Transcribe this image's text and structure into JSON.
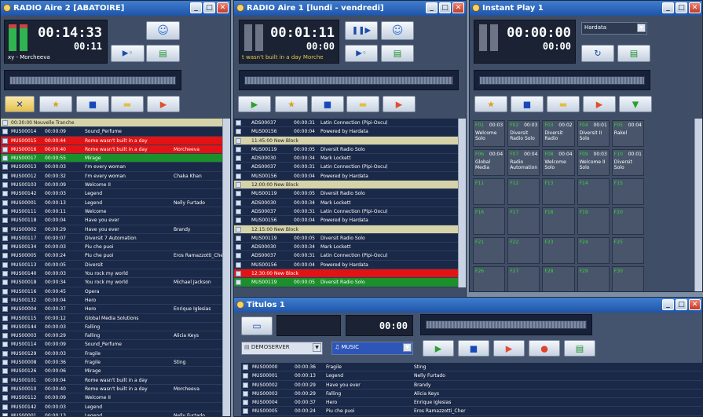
{
  "win1": {
    "title": "RADIO Aire 2 [ABATOIRE]",
    "time": "00:14:33",
    "sub": "00:11",
    "now": "xy - Morcheeva",
    "rows": [
      {
        "t": "ts",
        "icon": "",
        "id": "00:30:00 Nouvelle Tranche",
        "time": "",
        "title": "",
        "artist": ""
      },
      {
        "t": "",
        "icon": "",
        "id": "MUS00014",
        "time": "00:00:09",
        "title": "Sound_Perfume",
        "artist": ""
      },
      {
        "t": "red",
        "icon": "",
        "id": "MUS00015",
        "time": "00:00:44",
        "title": "Rome wasn't built in a day",
        "artist": ""
      },
      {
        "t": "red",
        "icon": "",
        "id": "MUS00016",
        "time": "00:00:40",
        "title": "Rome wasn't built in a day",
        "artist": "Morcheeva"
      },
      {
        "t": "green",
        "icon": "",
        "id": "MUS00017",
        "time": "00:00:55",
        "title": "Mirage",
        "artist": ""
      },
      {
        "t": "",
        "icon": "",
        "id": "MUS00013",
        "time": "00:00:03",
        "title": "I'm every woman",
        "artist": ""
      },
      {
        "t": "",
        "icon": "",
        "id": "MUS00012",
        "time": "00:00:32",
        "title": "I'm every woman",
        "artist": "Chaka Khan"
      },
      {
        "t": "",
        "icon": "",
        "id": "MUS00103",
        "time": "00:00:09",
        "title": "Welcome II",
        "artist": ""
      },
      {
        "t": "",
        "icon": "",
        "id": "MUS00142",
        "time": "00:00:03",
        "title": "Legend",
        "artist": ""
      },
      {
        "t": "",
        "icon": "",
        "id": "MUS00001",
        "time": "00:00:13",
        "title": "Legend",
        "artist": "Nelly Furtado"
      },
      {
        "t": "",
        "icon": "",
        "id": "MUS00111",
        "time": "00:00:11",
        "title": "Welcome",
        "artist": ""
      },
      {
        "t": "",
        "icon": "",
        "id": "MUS00118",
        "time": "00:00:04",
        "title": "Have you ever",
        "artist": ""
      },
      {
        "t": "",
        "icon": "",
        "id": "MUS00002",
        "time": "00:00:29",
        "title": "Have you ever",
        "artist": "Brandy"
      },
      {
        "t": "",
        "icon": "",
        "id": "MUS00117",
        "time": "00:00:07",
        "title": "Diversit 7 Automation",
        "artist": ""
      },
      {
        "t": "",
        "icon": "",
        "id": "MUS00134",
        "time": "00:00:03",
        "title": "Piu che puoi",
        "artist": ""
      },
      {
        "t": "",
        "icon": "",
        "id": "MUS00005",
        "time": "00:00:24",
        "title": "Piu che puoi",
        "artist": "Eros Ramazzotti_Cher"
      },
      {
        "t": "",
        "icon": "",
        "id": "MUS00113",
        "time": "00:00:05",
        "title": "Diversit",
        "artist": ""
      },
      {
        "t": "",
        "icon": "",
        "id": "MUS00140",
        "time": "00:00:03",
        "title": "You rock my world",
        "artist": ""
      },
      {
        "t": "",
        "icon": "",
        "id": "MUS00018",
        "time": "00:00:34",
        "title": "You rock my world",
        "artist": "Michael Jackson"
      },
      {
        "t": "",
        "icon": "",
        "id": "MUS00116",
        "time": "00:00:45",
        "title": "Opera",
        "artist": ""
      },
      {
        "t": "",
        "icon": "",
        "id": "MUS00132",
        "time": "00:00:04",
        "title": "Hero",
        "artist": ""
      },
      {
        "t": "",
        "icon": "",
        "id": "MUS00004",
        "time": "00:00:37",
        "title": "Hero",
        "artist": "Enrique Iglesias"
      },
      {
        "t": "",
        "icon": "",
        "id": "MUS00115",
        "time": "00:00:12",
        "title": "Global Media Solutions",
        "artist": ""
      },
      {
        "t": "",
        "icon": "",
        "id": "MUS00144",
        "time": "00:00:03",
        "title": "Falling",
        "artist": ""
      },
      {
        "t": "",
        "icon": "",
        "id": "MUS00003",
        "time": "00:00:29",
        "title": "Falling",
        "artist": "Alicia Keys"
      },
      {
        "t": "",
        "icon": "",
        "id": "MUS00114",
        "time": "00:00:09",
        "title": "Sound_Perfume",
        "artist": ""
      },
      {
        "t": "",
        "icon": "",
        "id": "MUS00129",
        "time": "00:00:03",
        "title": "Fragile",
        "artist": ""
      },
      {
        "t": "",
        "icon": "",
        "id": "MUS00008",
        "time": "00:00:36",
        "title": "Fragile",
        "artist": "Sting"
      },
      {
        "t": "",
        "icon": "",
        "id": "MUS00126",
        "time": "00:00:06",
        "title": "Mirage",
        "artist": ""
      },
      {
        "t": "",
        "icon": "",
        "id": "MUS00101",
        "time": "00:00:04",
        "title": "Rome wasn't built in a day",
        "artist": ""
      },
      {
        "t": "",
        "icon": "",
        "id": "MUS00010",
        "time": "00:00:40",
        "title": "Rome wasn't built in a day",
        "artist": "Morcheeva"
      },
      {
        "t": "",
        "icon": "",
        "id": "MUS00112",
        "time": "00:00:09",
        "title": "Welcome II",
        "artist": ""
      },
      {
        "t": "",
        "icon": "",
        "id": "MUS00142",
        "time": "00:00:03",
        "title": "Legend",
        "artist": ""
      },
      {
        "t": "",
        "icon": "",
        "id": "MUS00001",
        "time": "00:00:13",
        "title": "Legend",
        "artist": "Nelly Furtado"
      }
    ]
  },
  "win2": {
    "title": "RADIO Aire 1 [lundi - vendredi]",
    "time": "00:01:11",
    "sub": "00:00",
    "now": "t wasn't built in a day Morche",
    "rows": [
      {
        "t": "",
        "icon": "",
        "id": "ADS00037",
        "time": "00:00:31",
        "title": "Latin Connection (Pipi-Oxcu)",
        "artist": ""
      },
      {
        "t": "",
        "icon": "",
        "id": "MUS00156",
        "time": "00:00:04",
        "title": "Powered by Hardata",
        "artist": ""
      },
      {
        "t": "ts",
        "icon": "",
        "id": "11:45:00 New Block",
        "time": "",
        "title": "",
        "artist": ""
      },
      {
        "t": "",
        "icon": "",
        "id": "MUS00119",
        "time": "00:00:05",
        "title": "Diversit Radio Solo",
        "artist": ""
      },
      {
        "t": "",
        "icon": "",
        "id": "ADS00030",
        "time": "00:00:34",
        "title": "Mark Lockett",
        "artist": ""
      },
      {
        "t": "",
        "icon": "",
        "id": "ADS00037",
        "time": "00:00:31",
        "title": "Latin Connection (Pipi-Oxcu)",
        "artist": ""
      },
      {
        "t": "",
        "icon": "",
        "id": "MUS00156",
        "time": "00:00:04",
        "title": "Powered by Hardata",
        "artist": ""
      },
      {
        "t": "ts",
        "icon": "",
        "id": "12:00:00 New Block",
        "time": "",
        "title": "",
        "artist": ""
      },
      {
        "t": "",
        "icon": "",
        "id": "MUS00119",
        "time": "00:00:05",
        "title": "Diversit Radio Solo",
        "artist": ""
      },
      {
        "t": "",
        "icon": "",
        "id": "ADS00030",
        "time": "00:00:34",
        "title": "Mark Lockett",
        "artist": ""
      },
      {
        "t": "",
        "icon": "",
        "id": "ADS00037",
        "time": "00:00:31",
        "title": "Latin Connection (Pipi-Oxcu)",
        "artist": ""
      },
      {
        "t": "",
        "icon": "",
        "id": "MUS00156",
        "time": "00:00:04",
        "title": "Powered by Hardata",
        "artist": ""
      },
      {
        "t": "ts",
        "icon": "",
        "id": "12:15:00 New Block",
        "time": "",
        "title": "",
        "artist": ""
      },
      {
        "t": "",
        "icon": "",
        "id": "MUS00119",
        "time": "00:00:05",
        "title": "Diversit Radio Solo",
        "artist": ""
      },
      {
        "t": "",
        "icon": "",
        "id": "ADS00030",
        "time": "00:00:34",
        "title": "Mark Lockett",
        "artist": ""
      },
      {
        "t": "",
        "icon": "",
        "id": "ADS00037",
        "time": "00:00:31",
        "title": "Latin Connection (Pipi-Oxcu)",
        "artist": ""
      },
      {
        "t": "",
        "icon": "",
        "id": "MUS00156",
        "time": "00:00:04",
        "title": "Powered by Hardata",
        "artist": ""
      },
      {
        "t": "red",
        "icon": "",
        "id": "12:30:00 New Block",
        "time": "",
        "title": "",
        "artist": ""
      },
      {
        "t": "green",
        "icon": "",
        "id": "MUS00119",
        "time": "00:00:05",
        "title": "Diversit Radio Solo",
        "artist": ""
      }
    ]
  },
  "win3": {
    "title": "Instant Play 1",
    "time": "00:00:00",
    "sub": "00:00",
    "dropdown": "Hardata",
    "cells": [
      {
        "k": "F01",
        "d": "00:03",
        "n": "Welcome Solo"
      },
      {
        "k": "F02",
        "d": "00:03",
        "n": "Diversit Radio Solo"
      },
      {
        "k": "F03",
        "d": "00:02",
        "n": "Diversit Radio"
      },
      {
        "k": "F04",
        "d": "00:01",
        "n": "Diversit II Solo"
      },
      {
        "k": "F05",
        "d": "00:04",
        "n": "Rakel"
      },
      {
        "k": "F06",
        "d": "00:04",
        "n": "Global Media"
      },
      {
        "k": "F07",
        "d": "00:04",
        "n": "Radio Automation"
      },
      {
        "k": "F08",
        "d": "00:04",
        "n": "Welcome Solo"
      },
      {
        "k": "F09",
        "d": "00:03",
        "n": "Welcome II Solo"
      },
      {
        "k": "F10",
        "d": "00:01",
        "n": "Diversit Solo"
      },
      {
        "k": "F11",
        "d": "",
        "n": ""
      },
      {
        "k": "F12",
        "d": "",
        "n": ""
      },
      {
        "k": "F13",
        "d": "",
        "n": ""
      },
      {
        "k": "F14",
        "d": "",
        "n": ""
      },
      {
        "k": "F15",
        "d": "",
        "n": ""
      },
      {
        "k": "F16",
        "d": "",
        "n": ""
      },
      {
        "k": "F17",
        "d": "",
        "n": ""
      },
      {
        "k": "F18",
        "d": "",
        "n": ""
      },
      {
        "k": "F19",
        "d": "",
        "n": ""
      },
      {
        "k": "F20",
        "d": "",
        "n": ""
      },
      {
        "k": "F21",
        "d": "",
        "n": ""
      },
      {
        "k": "F22",
        "d": "",
        "n": ""
      },
      {
        "k": "F23",
        "d": "",
        "n": ""
      },
      {
        "k": "F24",
        "d": "",
        "n": ""
      },
      {
        "k": "F25",
        "d": "",
        "n": ""
      },
      {
        "k": "F26",
        "d": "",
        "n": ""
      },
      {
        "k": "F27",
        "d": "",
        "n": ""
      },
      {
        "k": "F28",
        "d": "",
        "n": ""
      },
      {
        "k": "F29",
        "d": "",
        "n": ""
      },
      {
        "k": "F30",
        "d": "",
        "n": ""
      }
    ]
  },
  "win4": {
    "title": "Titulos 1",
    "time": "00:00",
    "server": "DEMOSERVER",
    "category": "MUSIC",
    "rows": [
      {
        "id": "MUS00000",
        "time": "00:00:36",
        "title": "Fragile",
        "artist": "Sting"
      },
      {
        "id": "MUS00001",
        "time": "00:00:13",
        "title": "Legend",
        "artist": "Nelly Furtado"
      },
      {
        "id": "MUS00002",
        "time": "00:00:29",
        "title": "Have you ever",
        "artist": "Brandy"
      },
      {
        "id": "MUS00003",
        "time": "00:00:29",
        "title": "Falling",
        "artist": "Alicia Keys"
      },
      {
        "id": "MUS00004",
        "time": "00:00:37",
        "title": "Hero",
        "artist": "Enrique Iglesias"
      },
      {
        "id": "MUS00005",
        "time": "00:00:24",
        "title": "Piu che puoi",
        "artist": "Eros Ramazzotti_Cher"
      }
    ]
  }
}
